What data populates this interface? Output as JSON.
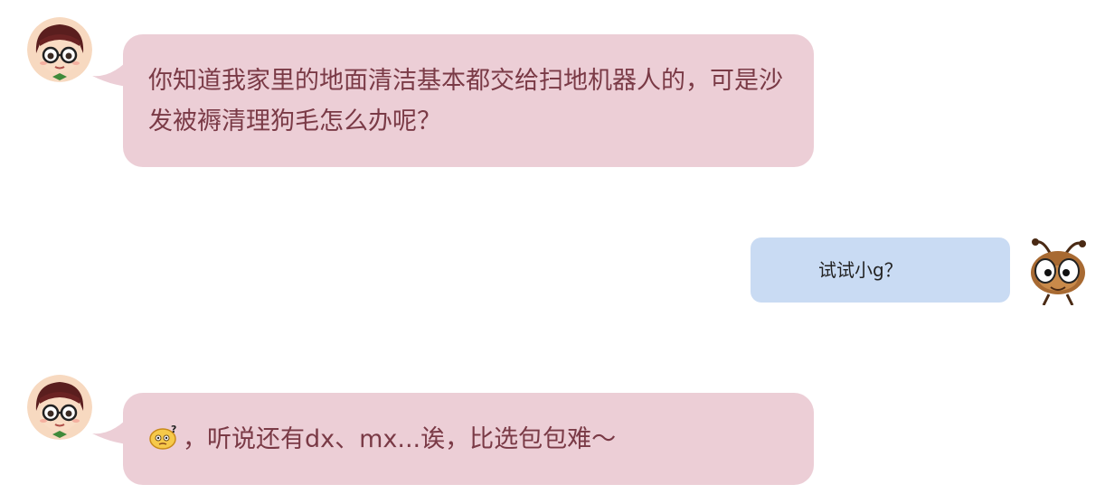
{
  "conversation": {
    "messages": [
      {
        "sender": "girl",
        "avatar_icon": "girl-with-glasses-avatar",
        "text": "你知道我家里的地面清洁基本都交给扫地机器人的，可是沙发被褥清理狗毛怎么办呢？"
      },
      {
        "sender": "ant",
        "avatar_icon": "cartoon-ant-avatar",
        "text": "试试小g？"
      },
      {
        "sender": "girl",
        "avatar_icon": "girl-with-glasses-avatar",
        "emoji": "thinking-face-emoji",
        "text": "，听说还有dx、mx...诶，比选包包难～"
      }
    ]
  },
  "colors": {
    "pink_bubble": "#ecced6",
    "pink_text": "#7a3a46",
    "blue_bubble": "#c9dbf3",
    "blue_text": "#222222"
  }
}
